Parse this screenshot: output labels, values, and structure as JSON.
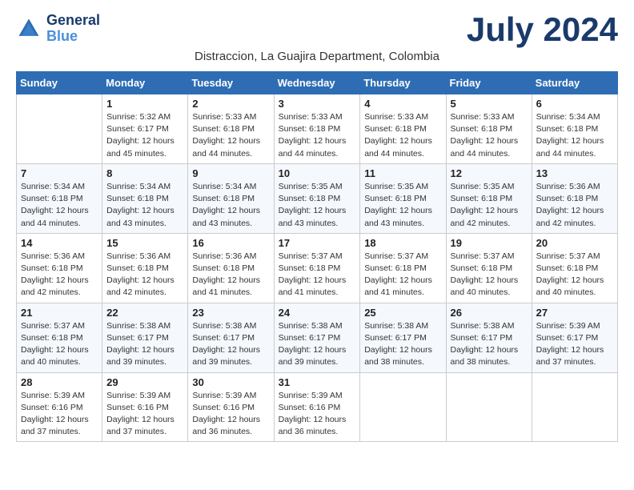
{
  "logo": {
    "line1": "General",
    "line2": "Blue"
  },
  "title": "July 2024",
  "subtitle": "Distraccion, La Guajira Department, Colombia",
  "weekdays": [
    "Sunday",
    "Monday",
    "Tuesday",
    "Wednesday",
    "Thursday",
    "Friday",
    "Saturday"
  ],
  "weeks": [
    [
      {
        "day": "",
        "sunrise": "",
        "sunset": "",
        "daylight": ""
      },
      {
        "day": "1",
        "sunrise": "Sunrise: 5:32 AM",
        "sunset": "Sunset: 6:17 PM",
        "daylight": "Daylight: 12 hours and 45 minutes."
      },
      {
        "day": "2",
        "sunrise": "Sunrise: 5:33 AM",
        "sunset": "Sunset: 6:18 PM",
        "daylight": "Daylight: 12 hours and 44 minutes."
      },
      {
        "day": "3",
        "sunrise": "Sunrise: 5:33 AM",
        "sunset": "Sunset: 6:18 PM",
        "daylight": "Daylight: 12 hours and 44 minutes."
      },
      {
        "day": "4",
        "sunrise": "Sunrise: 5:33 AM",
        "sunset": "Sunset: 6:18 PM",
        "daylight": "Daylight: 12 hours and 44 minutes."
      },
      {
        "day": "5",
        "sunrise": "Sunrise: 5:33 AM",
        "sunset": "Sunset: 6:18 PM",
        "daylight": "Daylight: 12 hours and 44 minutes."
      },
      {
        "day": "6",
        "sunrise": "Sunrise: 5:34 AM",
        "sunset": "Sunset: 6:18 PM",
        "daylight": "Daylight: 12 hours and 44 minutes."
      }
    ],
    [
      {
        "day": "7",
        "sunrise": "Sunrise: 5:34 AM",
        "sunset": "Sunset: 6:18 PM",
        "daylight": "Daylight: 12 hours and 44 minutes."
      },
      {
        "day": "8",
        "sunrise": "Sunrise: 5:34 AM",
        "sunset": "Sunset: 6:18 PM",
        "daylight": "Daylight: 12 hours and 43 minutes."
      },
      {
        "day": "9",
        "sunrise": "Sunrise: 5:34 AM",
        "sunset": "Sunset: 6:18 PM",
        "daylight": "Daylight: 12 hours and 43 minutes."
      },
      {
        "day": "10",
        "sunrise": "Sunrise: 5:35 AM",
        "sunset": "Sunset: 6:18 PM",
        "daylight": "Daylight: 12 hours and 43 minutes."
      },
      {
        "day": "11",
        "sunrise": "Sunrise: 5:35 AM",
        "sunset": "Sunset: 6:18 PM",
        "daylight": "Daylight: 12 hours and 43 minutes."
      },
      {
        "day": "12",
        "sunrise": "Sunrise: 5:35 AM",
        "sunset": "Sunset: 6:18 PM",
        "daylight": "Daylight: 12 hours and 42 minutes."
      },
      {
        "day": "13",
        "sunrise": "Sunrise: 5:36 AM",
        "sunset": "Sunset: 6:18 PM",
        "daylight": "Daylight: 12 hours and 42 minutes."
      }
    ],
    [
      {
        "day": "14",
        "sunrise": "Sunrise: 5:36 AM",
        "sunset": "Sunset: 6:18 PM",
        "daylight": "Daylight: 12 hours and 42 minutes."
      },
      {
        "day": "15",
        "sunrise": "Sunrise: 5:36 AM",
        "sunset": "Sunset: 6:18 PM",
        "daylight": "Daylight: 12 hours and 42 minutes."
      },
      {
        "day": "16",
        "sunrise": "Sunrise: 5:36 AM",
        "sunset": "Sunset: 6:18 PM",
        "daylight": "Daylight: 12 hours and 41 minutes."
      },
      {
        "day": "17",
        "sunrise": "Sunrise: 5:37 AM",
        "sunset": "Sunset: 6:18 PM",
        "daylight": "Daylight: 12 hours and 41 minutes."
      },
      {
        "day": "18",
        "sunrise": "Sunrise: 5:37 AM",
        "sunset": "Sunset: 6:18 PM",
        "daylight": "Daylight: 12 hours and 41 minutes."
      },
      {
        "day": "19",
        "sunrise": "Sunrise: 5:37 AM",
        "sunset": "Sunset: 6:18 PM",
        "daylight": "Daylight: 12 hours and 40 minutes."
      },
      {
        "day": "20",
        "sunrise": "Sunrise: 5:37 AM",
        "sunset": "Sunset: 6:18 PM",
        "daylight": "Daylight: 12 hours and 40 minutes."
      }
    ],
    [
      {
        "day": "21",
        "sunrise": "Sunrise: 5:37 AM",
        "sunset": "Sunset: 6:18 PM",
        "daylight": "Daylight: 12 hours and 40 minutes."
      },
      {
        "day": "22",
        "sunrise": "Sunrise: 5:38 AM",
        "sunset": "Sunset: 6:17 PM",
        "daylight": "Daylight: 12 hours and 39 minutes."
      },
      {
        "day": "23",
        "sunrise": "Sunrise: 5:38 AM",
        "sunset": "Sunset: 6:17 PM",
        "daylight": "Daylight: 12 hours and 39 minutes."
      },
      {
        "day": "24",
        "sunrise": "Sunrise: 5:38 AM",
        "sunset": "Sunset: 6:17 PM",
        "daylight": "Daylight: 12 hours and 39 minutes."
      },
      {
        "day": "25",
        "sunrise": "Sunrise: 5:38 AM",
        "sunset": "Sunset: 6:17 PM",
        "daylight": "Daylight: 12 hours and 38 minutes."
      },
      {
        "day": "26",
        "sunrise": "Sunrise: 5:38 AM",
        "sunset": "Sunset: 6:17 PM",
        "daylight": "Daylight: 12 hours and 38 minutes."
      },
      {
        "day": "27",
        "sunrise": "Sunrise: 5:39 AM",
        "sunset": "Sunset: 6:17 PM",
        "daylight": "Daylight: 12 hours and 37 minutes."
      }
    ],
    [
      {
        "day": "28",
        "sunrise": "Sunrise: 5:39 AM",
        "sunset": "Sunset: 6:16 PM",
        "daylight": "Daylight: 12 hours and 37 minutes."
      },
      {
        "day": "29",
        "sunrise": "Sunrise: 5:39 AM",
        "sunset": "Sunset: 6:16 PM",
        "daylight": "Daylight: 12 hours and 37 minutes."
      },
      {
        "day": "30",
        "sunrise": "Sunrise: 5:39 AM",
        "sunset": "Sunset: 6:16 PM",
        "daylight": "Daylight: 12 hours and 36 minutes."
      },
      {
        "day": "31",
        "sunrise": "Sunrise: 5:39 AM",
        "sunset": "Sunset: 6:16 PM",
        "daylight": "Daylight: 12 hours and 36 minutes."
      },
      {
        "day": "",
        "sunrise": "",
        "sunset": "",
        "daylight": ""
      },
      {
        "day": "",
        "sunrise": "",
        "sunset": "",
        "daylight": ""
      },
      {
        "day": "",
        "sunrise": "",
        "sunset": "",
        "daylight": ""
      }
    ]
  ]
}
